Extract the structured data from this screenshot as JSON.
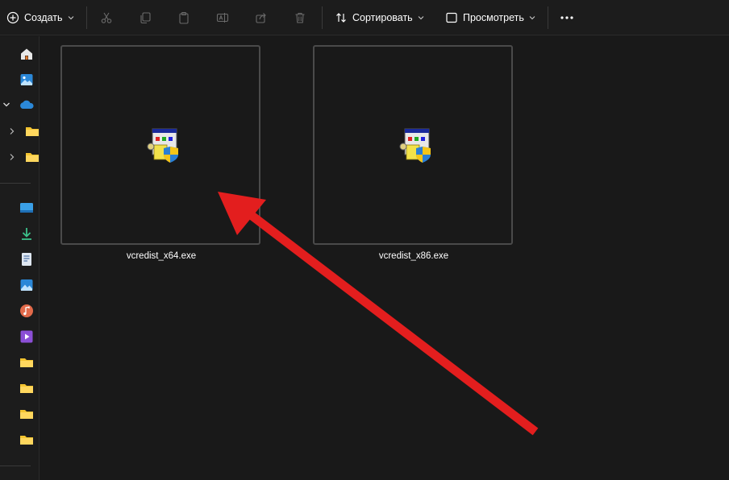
{
  "toolbar": {
    "create_label": "Создать",
    "sort_label": "Сортировать",
    "view_label": "Просмотреть",
    "icons": [
      "plus-circle-icon",
      "cut-icon",
      "copy-icon",
      "paste-icon",
      "rename-icon",
      "share-icon",
      "delete-icon",
      "sort-icon",
      "view-icon",
      "more-icon"
    ]
  },
  "sidebar": {
    "icons": [
      "home-icon",
      "gallery-icon",
      "onedrive-icon",
      "folder-icon",
      "folder-icon",
      "desktop-icon",
      "downloads-icon",
      "documents-icon",
      "pictures-icon",
      "music-icon",
      "videos-icon",
      "folder-icon",
      "folder-icon",
      "folder-icon",
      "folder-icon"
    ]
  },
  "files": [
    {
      "name": "vcredist_x64.exe",
      "icon": "installer-icon"
    },
    {
      "name": "vcredist_x86.exe",
      "icon": "installer-icon"
    }
  ],
  "colors": {
    "background": "#191919",
    "arrow": "#e31e1e",
    "folder": "#f4c430",
    "onedrive": "#2b88d8"
  }
}
